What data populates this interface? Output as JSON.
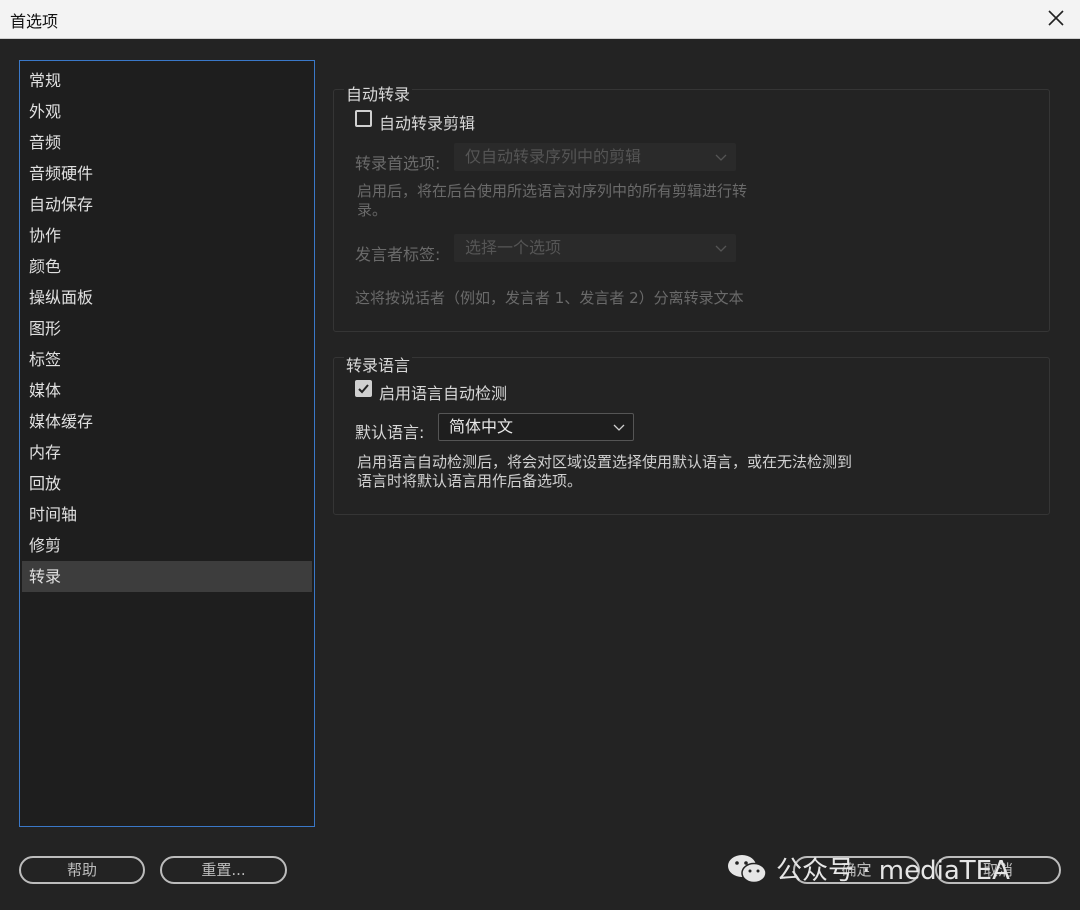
{
  "window": {
    "title": "首选项"
  },
  "sidebar": {
    "items": [
      {
        "label": "常规"
      },
      {
        "label": "外观"
      },
      {
        "label": "音频"
      },
      {
        "label": "音频硬件"
      },
      {
        "label": "自动保存"
      },
      {
        "label": "协作"
      },
      {
        "label": "颜色"
      },
      {
        "label": "操纵面板"
      },
      {
        "label": "图形"
      },
      {
        "label": "标签"
      },
      {
        "label": "媒体"
      },
      {
        "label": "媒体缓存"
      },
      {
        "label": "内存"
      },
      {
        "label": "回放"
      },
      {
        "label": "时间轴"
      },
      {
        "label": "修剪"
      },
      {
        "label": "转录"
      }
    ],
    "selected": "转录"
  },
  "auto_transcribe": {
    "group_title": "自动转录",
    "checkbox_label": "自动转录剪辑",
    "checkbox_checked": false,
    "pref_label": "转录首选项:",
    "pref_value": "仅自动转录序列中的剪辑",
    "pref_desc_line1": "启用后，将在后台使用所选语言对序列中的所有剪辑进行转",
    "pref_desc_line2": "录。",
    "speaker_label": "发言者标签:",
    "speaker_value": "选择一个选项",
    "speaker_desc": "这将按说话者（例如，发言者 1、发言者 2）分离转录文本"
  },
  "transcribe_language": {
    "group_title": "转录语言",
    "checkbox_label": "启用语言自动检测",
    "checkbox_checked": true,
    "default_label": "默认语言:",
    "default_value": "简体中文",
    "desc_line1": "启用语言自动检测后，将会对区域设置选择使用默认语言，或在无法检测到",
    "desc_line2": "语言时将默认语言用作后备选项。"
  },
  "footer": {
    "help_label": "帮助",
    "reset_label": "重置...",
    "ok_label": "确定",
    "cancel_label": "取消"
  },
  "watermark": {
    "text": "公众号 · mediaTEA"
  }
}
